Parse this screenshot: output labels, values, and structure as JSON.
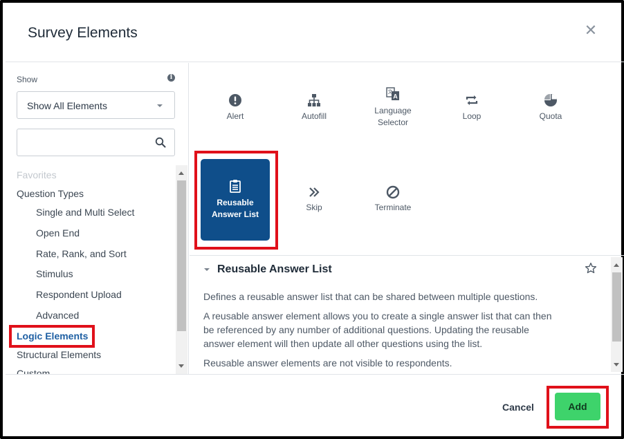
{
  "dialog": {
    "title": "Survey Elements",
    "close_icon": "close-icon"
  },
  "left": {
    "show_label": "Show",
    "info_icon": "info-icon",
    "filter_selected": "Show All Elements",
    "search_placeholder": "",
    "search_icon": "search-icon",
    "tree": {
      "favorites": "Favorites",
      "question_types": "Question Types",
      "sub_items": [
        "Single and Multi Select",
        "Open End",
        "Rate, Rank, and Sort",
        "Stimulus",
        "Respondent Upload",
        "Advanced"
      ],
      "logic_elements": "Logic Elements",
      "structural_elements": "Structural Elements",
      "custom": "Custom"
    }
  },
  "elements": {
    "alert": "Alert",
    "autofill": "Autofill",
    "language_selector_1": "Language",
    "language_selector_2": "Selector",
    "loop": "Loop",
    "quota": "Quota",
    "reusable_1": "Reusable",
    "reusable_2": "Answer List",
    "skip": "Skip",
    "terminate": "Terminate"
  },
  "detail": {
    "title": "Reusable Answer List",
    "star_icon": "star-icon",
    "p1": "Defines a reusable answer list that can be shared between multiple questions.",
    "p2_l1": "A reusable answer element allows you to create a single answer list that can then",
    "p2_l2": "be referenced by any number of additional questions. Updating the reusable",
    "p2_l3": "answer element will then update all other questions using the list.",
    "p3": "Reusable answer elements are not visible to respondents."
  },
  "footer": {
    "cancel_label": "Cancel",
    "add_label": "Add"
  },
  "colors": {
    "selected_tile": "#0f4e8a",
    "add_button": "#3ed36b",
    "active_link": "#1e5fa3",
    "highlight": "#e0101a"
  }
}
